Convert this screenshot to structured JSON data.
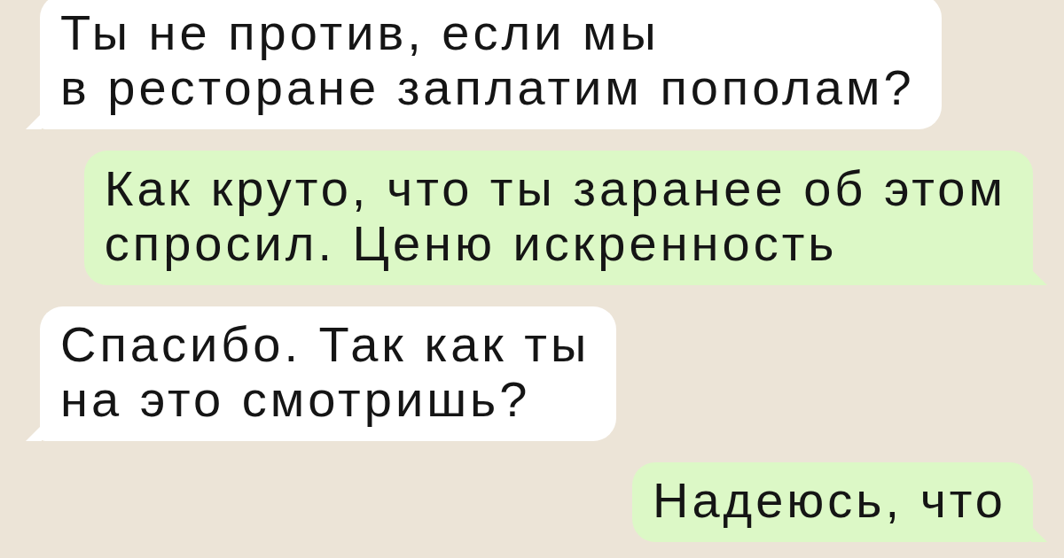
{
  "messages": [
    {
      "kind": "incoming",
      "text": "Ты не против, если мы\nв ресторане заплатим пополам?"
    },
    {
      "kind": "outgoing",
      "text": "Как круто, что ты заранее об этом\nспросил. Ценю искренность"
    },
    {
      "kind": "incoming",
      "text": "Спасибо. Так как ты\nна это смотришь?"
    },
    {
      "kind": "outgoing",
      "text": "Надеюсь, что"
    }
  ]
}
